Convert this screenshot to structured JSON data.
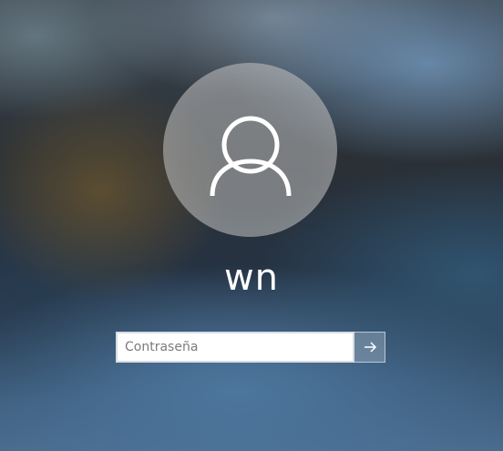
{
  "user": {
    "name": "wn",
    "avatar_icon": "person-icon"
  },
  "password": {
    "placeholder": "Contraseña",
    "value": ""
  },
  "submit": {
    "icon": "arrow-right-icon"
  },
  "colors": {
    "avatar_bg": "#9a9a9a",
    "input_border": "#d8dde2",
    "submit_bg": "#8ca0b4"
  }
}
